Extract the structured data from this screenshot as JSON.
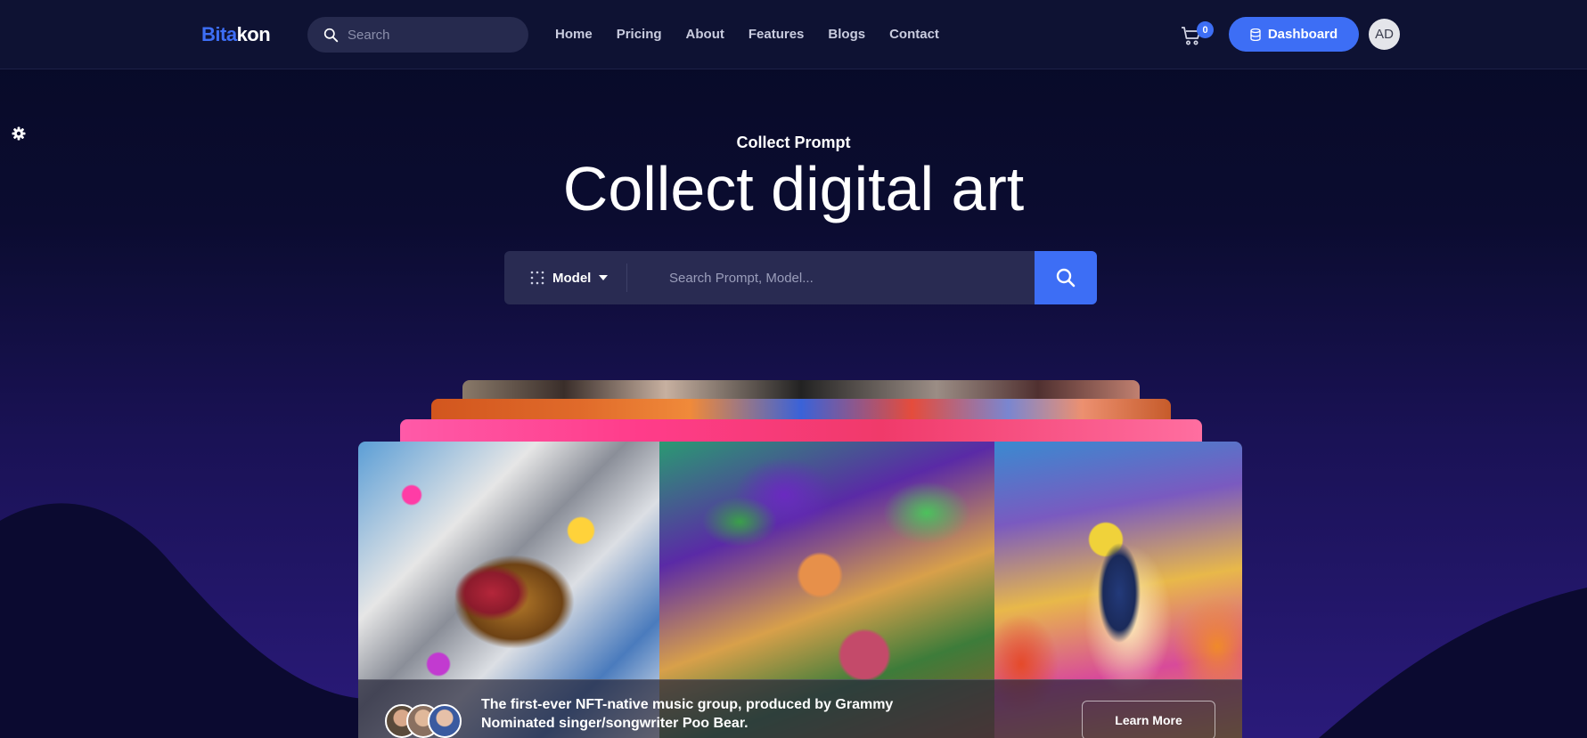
{
  "header": {
    "logo_part1": "Bita",
    "logo_part2": "kon",
    "search_placeholder": "Search",
    "nav": [
      "Home",
      "Pricing",
      "About",
      "Features",
      "Blogs",
      "Contact"
    ],
    "cart_count": "0",
    "dashboard_label": "Dashboard",
    "avatar_initials": "AD"
  },
  "hero": {
    "eyebrow": "Collect Prompt",
    "title": "Collect digital art",
    "model_label": "Model",
    "search_placeholder": "Search Prompt, Model..."
  },
  "featured": {
    "caption": "The first-ever NFT-native music group, produced by Grammy Nominated singer/songwriter Poo Bear.",
    "button_label": "Learn More"
  },
  "colors": {
    "accent": "#3d6ef5",
    "header_bg": "#0e1233",
    "search_bg": "#292b52"
  },
  "icons": [
    "search-icon",
    "cart-icon",
    "database-icon",
    "gear-icon",
    "grid-dots-icon",
    "caret-down-icon"
  ]
}
